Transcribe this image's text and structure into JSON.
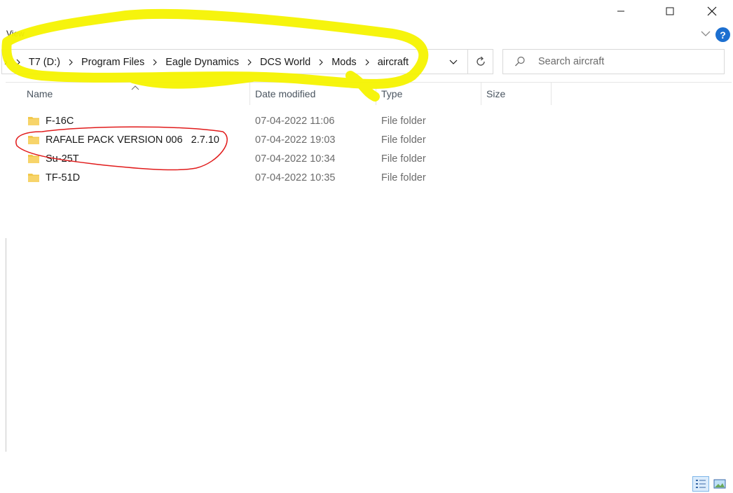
{
  "ribbon": {
    "view_label": "View",
    "help_label": "?"
  },
  "window_controls": {
    "minimize": "minimize",
    "maximize": "maximize",
    "close": "close"
  },
  "address": {
    "overflow": "›",
    "crumbs": [
      "T7 (D:)",
      "Program Files",
      "Eagle Dynamics",
      "DCS World",
      "Mods",
      "aircraft"
    ]
  },
  "search": {
    "placeholder": "Search aircraft"
  },
  "columns": {
    "name": "Name",
    "date": "Date modified",
    "type": "Type",
    "size": "Size"
  },
  "files": [
    {
      "name": "F-16C",
      "date": "07-04-2022 11:06",
      "type": "File folder"
    },
    {
      "name": "RAFALE PACK VERSION 006   2.7.10",
      "date": "07-04-2022 19:03",
      "type": "File folder"
    },
    {
      "name": "Su-25T",
      "date": "07-04-2022 10:34",
      "type": "File folder"
    },
    {
      "name": "TF-51D",
      "date": "07-04-2022 10:35",
      "type": "File folder"
    }
  ],
  "colors": {
    "annotation_yellow": "#f6f300",
    "annotation_red": "#e11b1b",
    "folder": "#f2c84b",
    "help_blue": "#1c6fd0"
  }
}
